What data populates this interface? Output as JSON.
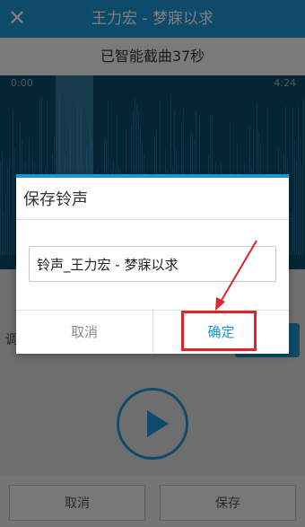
{
  "header": {
    "close_icon": "close-icon",
    "title": "王力宏 - 梦寐以求"
  },
  "subheader": {
    "text": "已智能截曲37秒"
  },
  "waveform": {
    "start_time": "0:00",
    "end_time": "4:24"
  },
  "bottom_bar": {
    "cancel_label": "取消",
    "save_label": "保存"
  },
  "play_icon": "play-icon",
  "dialog": {
    "title": "保存铃声",
    "input_value": "铃声_王力宏 - 梦寐以求",
    "cancel_label": "取消",
    "ok_label": "确定"
  },
  "colors": {
    "accent": "#1d95d2",
    "annotation": "#e0242b"
  }
}
